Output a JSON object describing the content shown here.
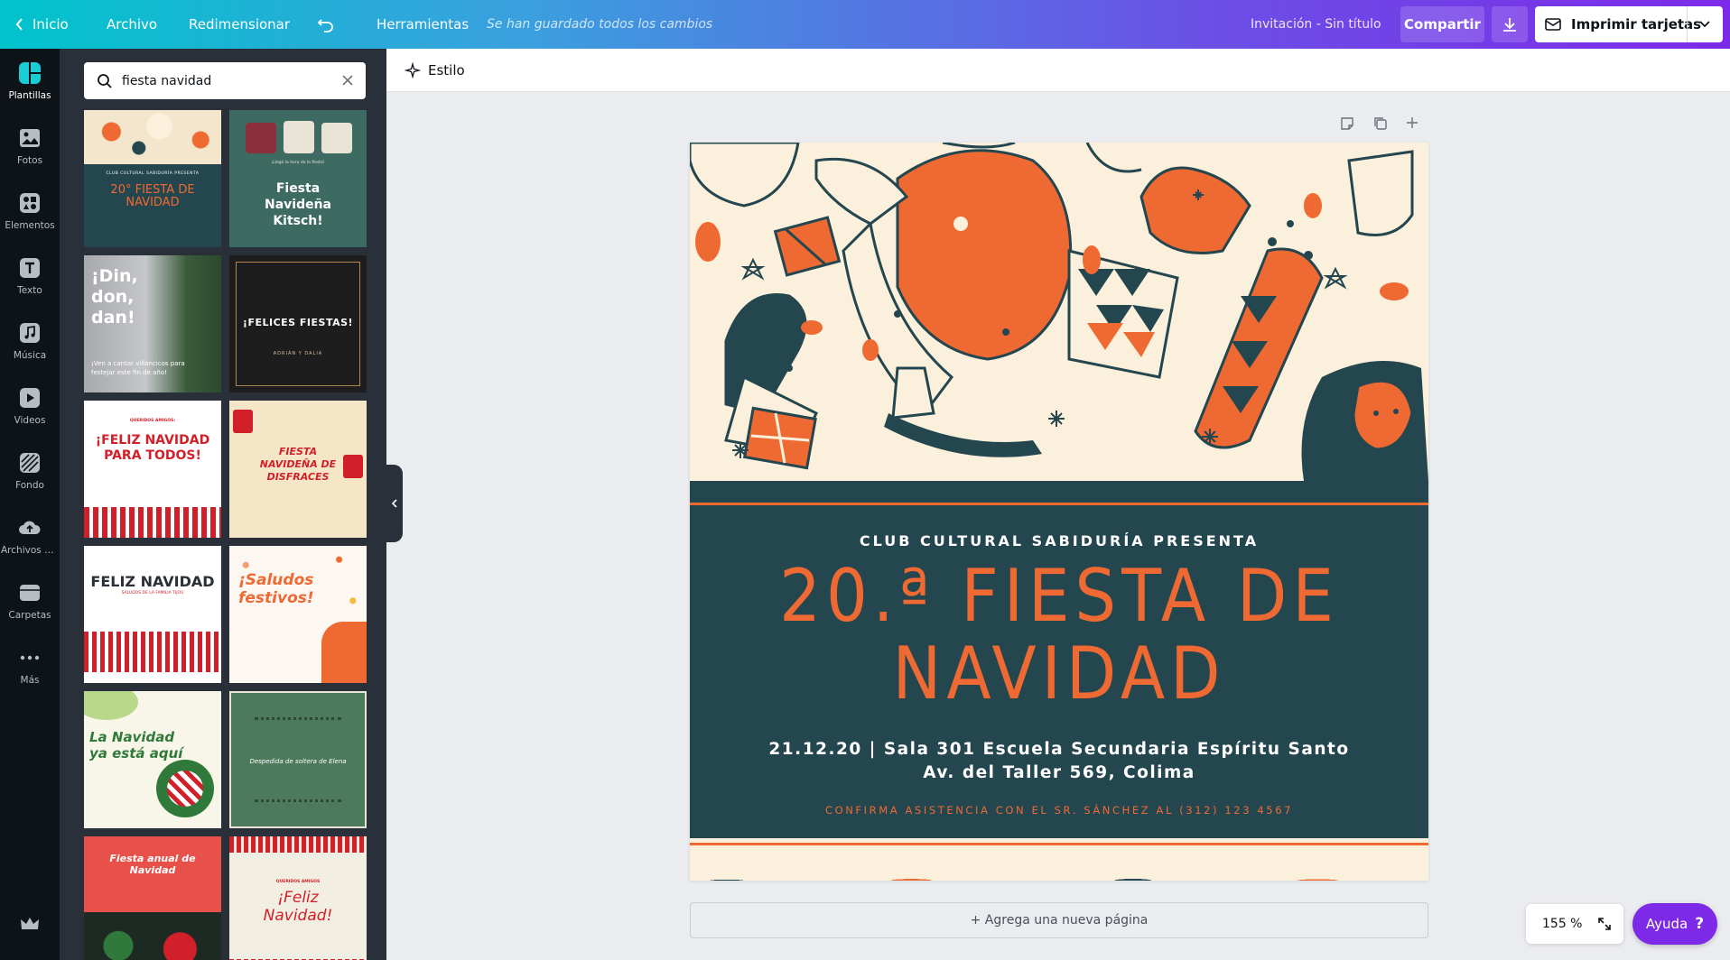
{
  "topbar": {
    "home_label": "Inicio",
    "file_label": "Archivo",
    "resize_label": "Redimensionar",
    "tools_label": "Herramientas",
    "saved_status": "Se han guardado todos los cambios",
    "doc_title": "Invitación - Sin título",
    "share_label": "Compartir",
    "print_label": "Imprimir tarjetas"
  },
  "rail": {
    "items": [
      {
        "label": "Plantillas",
        "icon": "templates-icon"
      },
      {
        "label": "Fotos",
        "icon": "photos-icon"
      },
      {
        "label": "Elementos",
        "icon": "elements-icon"
      },
      {
        "label": "Texto",
        "icon": "text-icon"
      },
      {
        "label": "Música",
        "icon": "music-icon"
      },
      {
        "label": "Videos",
        "icon": "video-icon"
      },
      {
        "label": "Fondo",
        "icon": "background-icon"
      },
      {
        "label": "Archivos su...",
        "icon": "upload-icon"
      },
      {
        "label": "Carpetas",
        "icon": "folder-icon"
      },
      {
        "label": "Más",
        "icon": "more-icon"
      }
    ]
  },
  "panel": {
    "search_value": "fiesta navidad",
    "templates": [
      {
        "title": "20° FIESTA DE NAVIDAD",
        "sub": "CLUB CULTURAL SABIDURÍA PRESENTA"
      },
      {
        "title": "Fiesta Navideña Kitsch!",
        "sub": "¡Llegó la hora de la fiesta!"
      },
      {
        "title": "¡Din, don, dan!",
        "sub": "¡Ven a cantar villancicos para festejar este fin de año!"
      },
      {
        "title": "¡FELICES FIESTAS!",
        "sub": "ADRIÁN Y DALIA"
      },
      {
        "title": "¡FELIZ NAVIDAD PARA TODOS!",
        "sub": "QUERIDOS AMIGOS:"
      },
      {
        "title": "FIESTA NAVIDEÑA DE DISFRACES",
        "sub": ""
      },
      {
        "title": "FELIZ NAVIDAD",
        "sub": "SALUDOS DE LA FAMILIA TIJOU"
      },
      {
        "title": "¡Saludos festivos!",
        "sub": ""
      },
      {
        "title": "La Navidad ya está aquí",
        "sub": ""
      },
      {
        "title": "Despedida de soltera de Elena",
        "sub": ""
      },
      {
        "title": "Fiesta anual de Navidad",
        "sub": ""
      },
      {
        "title": "¡Feliz Navidad!",
        "sub": "QUERIDOS AMIGOS"
      }
    ]
  },
  "toolbar": {
    "style_label": "Estilo"
  },
  "design": {
    "club_line": "CLUB CULTURAL SABIDURÍA PRESENTA",
    "title_line1": "20.ª FIESTA DE",
    "title_line2": "NAVIDAD",
    "details_line1": "21.12.20 | Sala 301 Escuela Secundaria Espíritu Santo",
    "details_line2": "Av. del Taller 569, Colima",
    "confirm_line": "CONFIRMA ASISTENCIA CON EL SR. SÁNCHEZ AL (312) 123 4567"
  },
  "add_page_label": "+ Agrega una nueva página",
  "zoom_value": "155 %",
  "help_label": "Ayuda",
  "colors": {
    "accent": "#7d2ae8",
    "teal": "#00c4cc",
    "orange": "#ef6a33",
    "dark_teal": "#24464f",
    "cream": "#fbf0db"
  }
}
